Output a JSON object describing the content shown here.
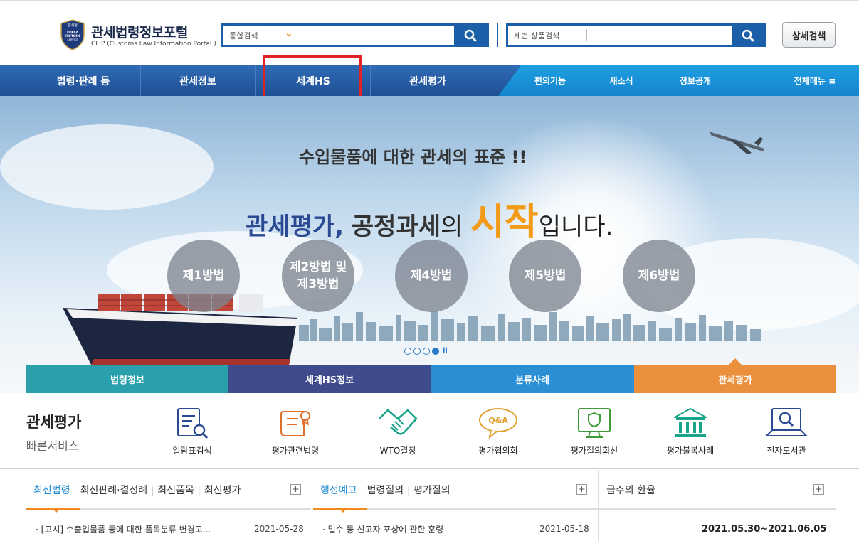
{
  "header": {
    "logo_title": "관세법령정보포털",
    "logo_subtitle": "CLIP (Customs Law Information Portal )",
    "emblem_top": "관세청",
    "emblem_text1": "KOREA",
    "emblem_text2": "CUSTOMS",
    "emblem_text3": "SERVICE",
    "search1_select": "통합검색",
    "search2_select": "세번·상품검색",
    "detail_search": "상세검색"
  },
  "nav": {
    "items": [
      "법령·판례 등",
      "관세정보",
      "세계HS",
      "관세평가"
    ],
    "sub_items": [
      "편의기능",
      "새소식",
      "정보공개"
    ],
    "all_menu": "전체메뉴 ≡"
  },
  "banner": {
    "tagline": "수입물품에 대한 관세의 표준 !!",
    "main_blue": "관세평가,",
    "main_dark": "공정과세",
    "main_light": "의",
    "main_orange": "시작",
    "main_end": "입니다.",
    "circles": [
      "제1방법",
      "제2방법 및 제3방법",
      "제4방법",
      "제5방법",
      "제6방법"
    ],
    "slides": 4,
    "active_slide": 4
  },
  "category_tabs": [
    "법령정보",
    "세계HS정보",
    "분류사례",
    "관세평가"
  ],
  "quick": {
    "title": "관세평가",
    "subtitle": "빠른서비스",
    "items": [
      "일람표검색",
      "평가관련법령",
      "WTO결정",
      "평가협의회",
      "평가질의회신",
      "평가불복사례",
      "전자도서관"
    ]
  },
  "news1": {
    "tabs": [
      "최신법령",
      "최신판례·결정례",
      "최신품목",
      "최신평가"
    ],
    "row_text": "· [고시] 수출입물품 등에 대한 품목분류 변경고...",
    "row_date": "2021-05-28"
  },
  "news2": {
    "tabs": [
      "행정예고",
      "법령질의",
      "평가질의"
    ],
    "row_text": "· 밀수 등 신고자 포상에 관한 훈령",
    "row_date": "2021-05-18"
  },
  "exchange": {
    "title": "금주의 환율",
    "period": "2021.05.30~2021.06.05"
  },
  "colors": {
    "nav_blue": "#1f4f93",
    "accent_orange": "#f39a16",
    "highlight_red": "#e32228"
  }
}
